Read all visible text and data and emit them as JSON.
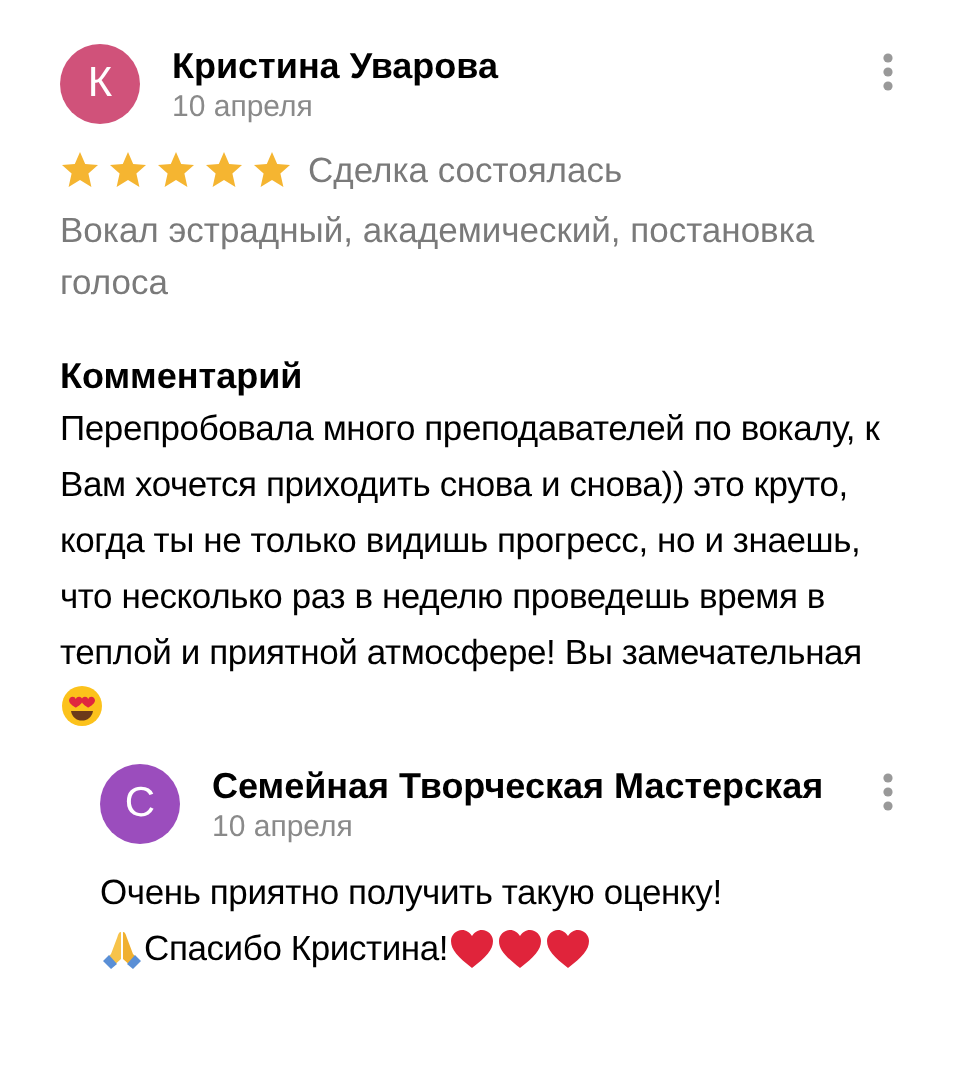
{
  "review": {
    "avatar": {
      "letter": "К",
      "color": "#d0527a"
    },
    "author": "Кристина Уварова",
    "date": "10 апреля",
    "stars": 5,
    "deal_status": "Сделка состоялась",
    "service": "Вокал эстрадный, академический, постановка голоса",
    "comment_heading": "Комментарий",
    "comment": "Перепробовала много преподавателей по вокалу, к Вам хочется приходить снова и снова)) это круто, когда ты не только видишь прогресс, но и знаешь, что несколько раз в неделю проведешь время в теплой и приятной атмосфере! Вы замечательная"
  },
  "reply": {
    "avatar": {
      "letter": "С",
      "color": "#9b4dbd"
    },
    "author": "Семейная Творческая Мастерская",
    "date": "10 апреля",
    "lines": [
      "Очень приятно получить такую оценку!",
      "Спасибо Кристина!"
    ]
  }
}
